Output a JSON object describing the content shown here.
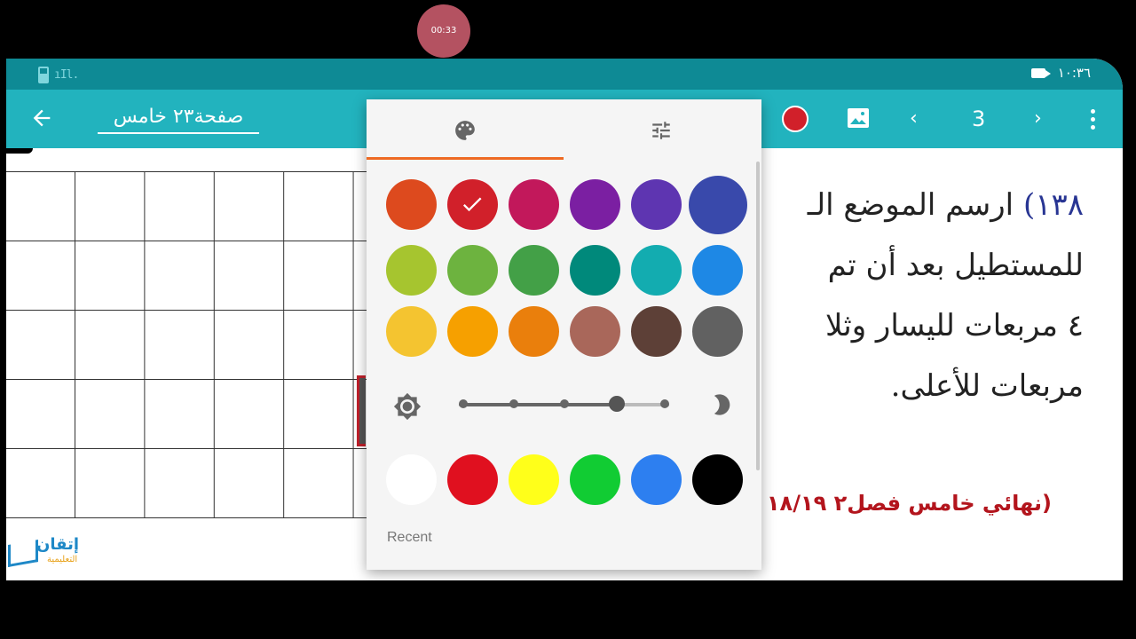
{
  "status": {
    "time": "١٠:٣٦",
    "signal": "ıIl."
  },
  "recorder": {
    "elapsed": "00:33"
  },
  "appbar": {
    "title": "صفحة٢٣ خامس",
    "page_number": "3",
    "current_color": "#d1202a"
  },
  "question": {
    "number": "١٣٨)",
    "lines": [
      "ارسم الموضع الـ",
      "للمستطيل بعد أن تم",
      "٤ مربعات لليسار وثلا",
      "مربعات  للأعلى."
    ],
    "exam_note": "(نهائي خامس فصل٢ ١٨/١٩"
  },
  "logo": {
    "name": "إتقان",
    "sub": "التعليمية"
  },
  "picker": {
    "tabs": [
      {
        "icon": "palette-icon",
        "active": true
      },
      {
        "icon": "sliders-icon",
        "active": false
      }
    ],
    "palette_rows": [
      [
        "#dd4a1e",
        "#d1202a",
        "#c2185b",
        "#7b1fa2",
        "#5e35b1",
        "#3949ab"
      ],
      [
        "#a6c52f",
        "#6db33f",
        "#43a047",
        "#00897b",
        "#13acb0",
        "#1e88e5"
      ],
      [
        "#f4c430",
        "#f6a000",
        "#ea7f0c",
        "#a9675a",
        "#5d4037",
        "#616161"
      ]
    ],
    "selected_color": "#d1202a",
    "brightness_level": 0.75,
    "basic_colors": [
      "#ffffff",
      "#e0101f",
      "#ffff1a",
      "#11cc33",
      "#2d7ff0",
      "#000000"
    ],
    "recent_label": "Recent"
  }
}
